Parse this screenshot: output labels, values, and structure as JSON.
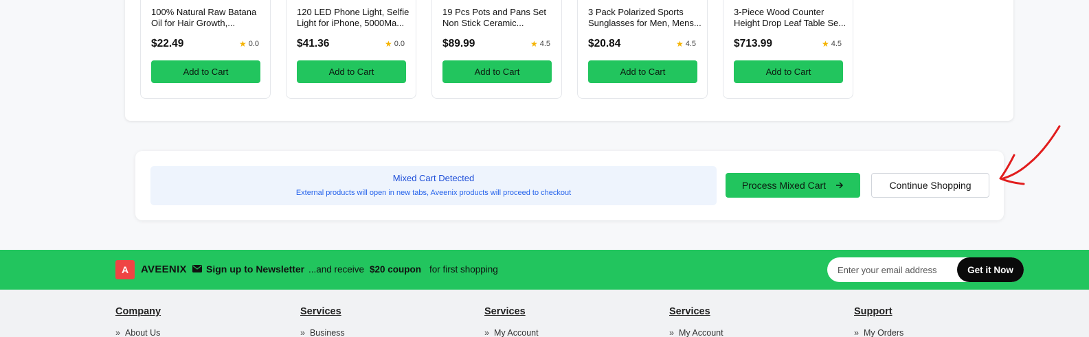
{
  "products": [
    {
      "title": "100% Natural Raw Batana Oil for Hair Growth,...",
      "price": "$22.49",
      "rating": "0.0",
      "button": "Add to Cart",
      "thumb_color": "#9c7b57"
    },
    {
      "title": "120 LED Phone Light, Selfie Light for iPhone, 5000Ma...",
      "price": "$41.36",
      "rating": "0.0",
      "button": "Add to Cart",
      "thumb_color": "#4b4b4b"
    },
    {
      "title": "19 Pcs Pots and Pans Set Non Stick Ceramic...",
      "price": "$89.99",
      "rating": "4.5",
      "button": "Add to Cart",
      "thumb_color": "#e8e8e8"
    },
    {
      "title": "3 Pack Polarized Sports Sunglasses for Men, Mens...",
      "price": "$20.84",
      "rating": "4.5",
      "button": "Add to Cart",
      "thumb_color": "#2b2b2b"
    },
    {
      "title": "3-Piece Wood Counter Height Drop Leaf Table Se...",
      "price": "$713.99",
      "rating": "4.5",
      "button": "Add to Cart",
      "thumb_color": "#a08a78"
    }
  ],
  "mixed_cart": {
    "title": "Mixed Cart Detected",
    "subtitle": "External products will open in new tabs, Aveenix products will proceed to checkout",
    "process_label": "Process Mixed Cart",
    "continue_label": "Continue Shopping"
  },
  "newsletter": {
    "brand_letter": "A",
    "brand_name": "AVEENIX",
    "signup": "Sign up to Newsletter",
    "receive": "...and receive",
    "coupon": "$20 coupon",
    "first": "for first shopping",
    "email_placeholder": "Enter your email address",
    "button": "Get it Now"
  },
  "footer": {
    "columns": [
      {
        "heading": "Company",
        "first_link": "About Us"
      },
      {
        "heading": "Services",
        "first_link": "Business"
      },
      {
        "heading": "Services",
        "first_link": "My Account"
      },
      {
        "heading": "Services",
        "first_link": "My Account"
      },
      {
        "heading": "Support",
        "first_link": "My Orders"
      }
    ]
  },
  "colors": {
    "accent": "#22c55e",
    "brand_red": "#ef4444",
    "notice_bg": "#eef4fd",
    "notice_text": "#1d4ed8",
    "annotation": "#e11d1d"
  }
}
